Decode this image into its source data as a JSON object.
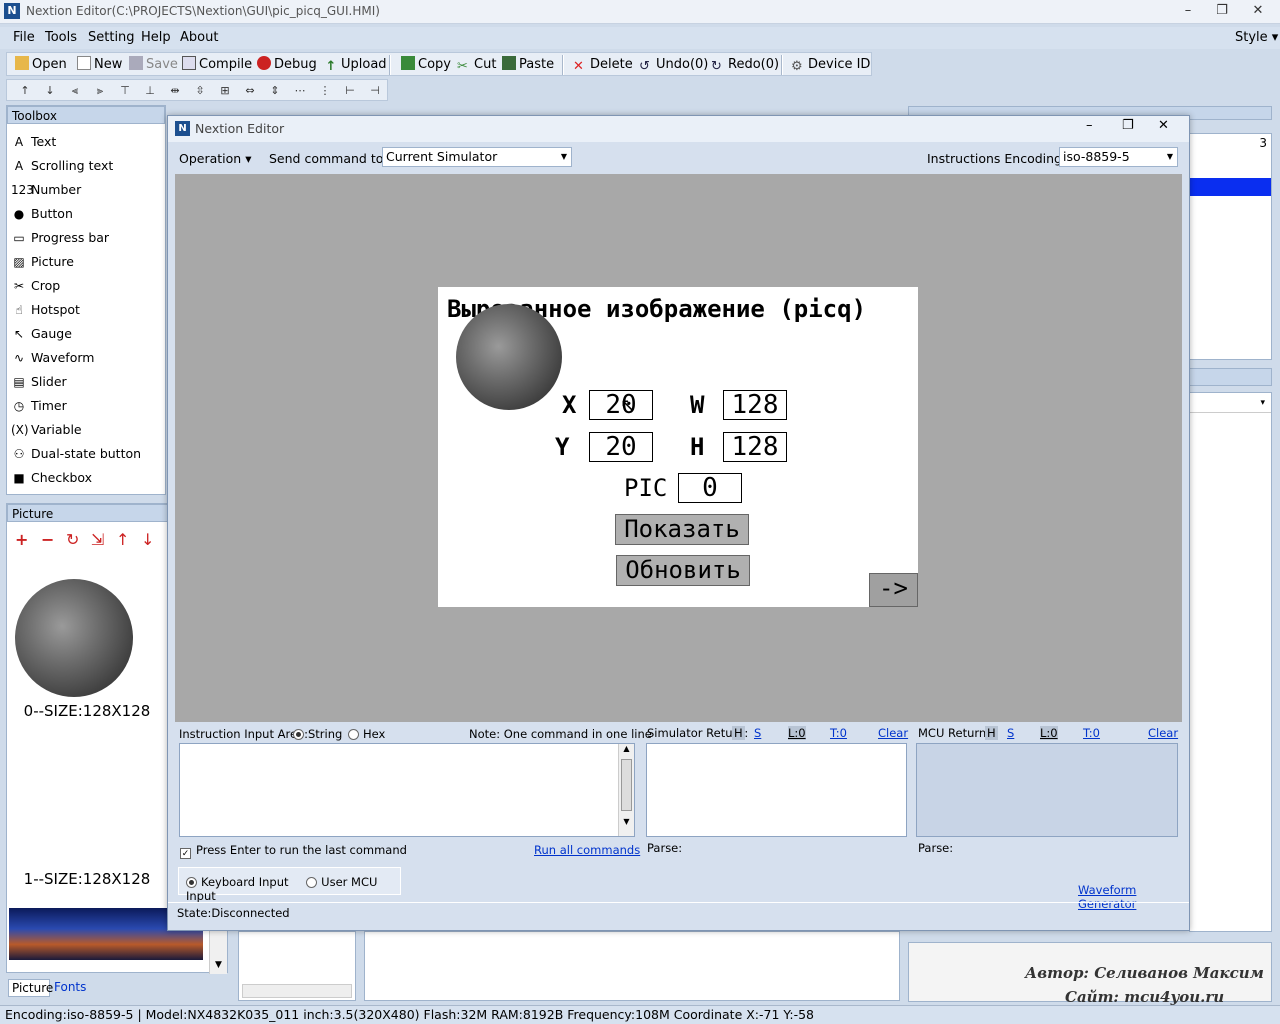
{
  "window": {
    "title": "Nextion Editor(C:\\PROJECTS\\Nextion\\GUI\\pic_picq_GUI.HMI)",
    "logo": "N"
  },
  "menu": {
    "file": "File",
    "tools": "Tools",
    "setting": "Setting",
    "help": "Help",
    "about": "About",
    "style": "Style"
  },
  "toolbar": {
    "open": "Open",
    "new": "New",
    "save": "Save",
    "compile": "Compile",
    "debug": "Debug",
    "upload": "Upload",
    "copy": "Copy",
    "cut": "Cut",
    "paste": "Paste",
    "delete": "Delete",
    "undo": "Undo(0)",
    "redo": "Redo(0)",
    "device_id": "Device  ID"
  },
  "toolbox": {
    "title": "Toolbox",
    "items": [
      {
        "label": "Text",
        "icon": "A"
      },
      {
        "label": "Scrolling text",
        "icon": "A"
      },
      {
        "label": "Number",
        "icon": "123"
      },
      {
        "label": "Button",
        "icon": "●"
      },
      {
        "label": "Progress bar",
        "icon": "▭"
      },
      {
        "label": "Picture",
        "icon": "▨"
      },
      {
        "label": "Crop",
        "icon": "✂"
      },
      {
        "label": "Hotspot",
        "icon": "☝"
      },
      {
        "label": "Gauge",
        "icon": "↖"
      },
      {
        "label": "Waveform",
        "icon": "∿"
      },
      {
        "label": "Slider",
        "icon": "▤"
      },
      {
        "label": "Timer",
        "icon": "◷"
      },
      {
        "label": "Variable",
        "icon": "(X)"
      },
      {
        "label": "Dual-state button",
        "icon": "⚇"
      },
      {
        "label": "Checkbox",
        "icon": "■"
      }
    ]
  },
  "picture_panel": {
    "title": "Picture",
    "items": [
      {
        "label": "0--SIZE:128X128"
      },
      {
        "label": "1--SIZE:128X128"
      }
    ],
    "tabs": {
      "picture": "Picture",
      "fonts": "Fonts"
    }
  },
  "right_panel": {
    "number": "3"
  },
  "dialog": {
    "title": "Nextion Editor",
    "operation": "Operation",
    "send_command_label": "Send command to:",
    "send_command_value": "Current Simulator",
    "encoding_label": "Instructions Encoding:",
    "encoding_value": "iso-8859-5",
    "screen": {
      "title": "Вырезанное изображение (picq)",
      "x_label": "X",
      "x_value": "20",
      "y_label": "Y",
      "y_value": "20",
      "w_label": "W",
      "w_value": "128",
      "h_label": "H",
      "h_value": "128",
      "pic_label": "PIC",
      "pic_value": "0",
      "show_button": "Показать",
      "refresh_button": "Обновить",
      "next_button": "->"
    },
    "instruction": {
      "label": "Instruction Input Area:",
      "string": "String",
      "hex": "Hex",
      "note": "Note: One command in one line",
      "enter_checkbox": "Press Enter to run the last command",
      "run_all": "Run all commands",
      "keyboard_input": "Keyboard Input",
      "user_mcu_input": "User MCU Input"
    },
    "sim_return": {
      "label": "Simulator Return:",
      "h": "H",
      "s": "S",
      "l": "L:0",
      "t": "T:0",
      "clear": "Clear",
      "parse": "Parse:"
    },
    "mcu_return": {
      "label": "MCU Return:",
      "h": "H",
      "s": "S",
      "l": "L:0",
      "t": "T:0",
      "clear": "Clear",
      "parse": "Parse:"
    },
    "waveform_generator": "Waveform Generator",
    "state": "State:Disconnected"
  },
  "watermark": {
    "line1": "Автор: Селиванов Максим",
    "line2": "Сайт: mcu4you.ru"
  },
  "statusbar": {
    "text": "Encoding:iso-8859-5 | Model:NX4832K035_011  inch:3.5(320X480) Flash:32M RAM:8192B Frequency:108M    Coordinate X:-71  Y:-58"
  }
}
